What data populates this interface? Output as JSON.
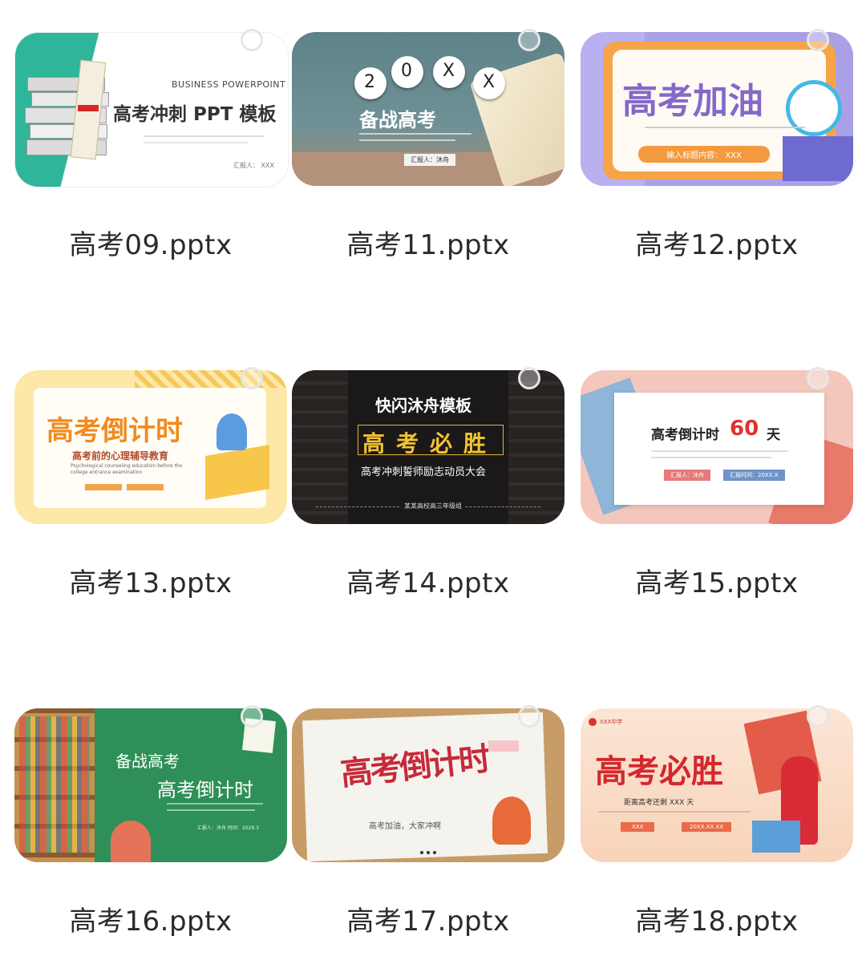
{
  "files": [
    {
      "name": "高考09.pptx",
      "preview": {
        "header": "BUSINESS POWERPOINT",
        "title": "高考冲刺 PPT 模板",
        "reporter": "汇报人：  XXX"
      }
    },
    {
      "name": "高考11.pptx",
      "preview": {
        "chips": [
          "2",
          "0",
          "X",
          "X"
        ],
        "title": "备战高考",
        "reporter": "汇报人：沐舟"
      }
    },
    {
      "name": "高考12.pptx",
      "preview": {
        "title": "高考加油",
        "input": "输入标题内容：  XXX"
      }
    },
    {
      "name": "高考13.pptx",
      "preview": {
        "title": "高考倒计时",
        "subtitle": "高考前的心理辅导教育",
        "eng": "Psychological counseling education before the college entrance examination"
      }
    },
    {
      "name": "高考14.pptx",
      "preview": {
        "top": "快闪沐舟模板",
        "title": "高考必胜",
        "sub": "高考冲刺誓师励志动员大会",
        "footer": "某某高校高三年级组"
      }
    },
    {
      "name": "高考15.pptx",
      "preview": {
        "title": "高考倒计时",
        "days": "60",
        "unit": "天",
        "reporter": "汇报人：沐舟",
        "date": "汇报时间：20XX.X"
      }
    },
    {
      "name": "高考16.pptx",
      "preview": {
        "line1": "备战高考",
        "line2": "高考倒计时",
        "reporter": "汇报人：沐舟    时间：2029.3"
      }
    },
    {
      "name": "高考17.pptx",
      "preview": {
        "title": "高考倒计时",
        "sub": "高考加油，大家冲啊"
      }
    },
    {
      "name": "高考18.pptx",
      "preview": {
        "school": "XXX中学",
        "title": "高考必胜",
        "sub": "距离高考还剩 XXX 天",
        "btn1": "XXX",
        "btn2": "20XX.XX.XX"
      }
    }
  ],
  "colors": {
    "text": "#2a2a2a",
    "selection_ring": "#e6e6e6"
  }
}
